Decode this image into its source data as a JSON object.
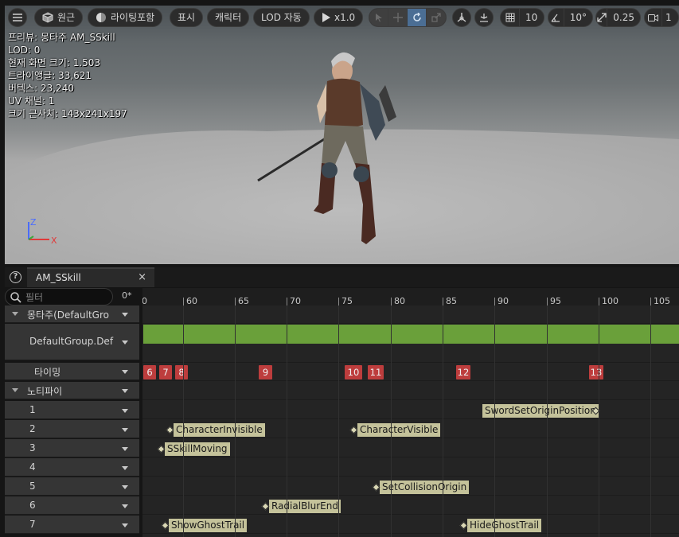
{
  "viewport": {
    "toolbar": {
      "perspective_label": "원근",
      "lighting_label": "라이팅포함",
      "show_label": "표시",
      "character_label": "캐릭터",
      "lod_label": "LOD 자동",
      "play_speed_label": "x1.0",
      "grid_size": "10",
      "rotation_snap": "10°",
      "scale_snap": "0.25",
      "camera_speed": "1"
    },
    "stats": [
      "프리뷰: 몽타주 AM_SSkill",
      "LOD: 0",
      "현재 화면 크기: 1.503",
      "트라이앵글: 33,621",
      "버텍스: 23,240",
      "UV 채널: 1",
      "크기 근사치: 143x241x197"
    ],
    "axis": {
      "z": "Z",
      "x": "X"
    }
  },
  "tab": {
    "label": "AM_SSkill",
    "close": "×",
    "help": "?"
  },
  "filter": {
    "placeholder": "필터",
    "frame": "0*"
  },
  "tracks": [
    {
      "label": "몽타주(DefaultGro",
      "kind": "section"
    },
    {
      "label": "DefaultGroup.Def",
      "kind": "slot"
    },
    {
      "label": "타이밍",
      "kind": "timing"
    },
    {
      "label": "노티파이",
      "kind": "section"
    },
    {
      "label": "1",
      "kind": "notify"
    },
    {
      "label": "2",
      "kind": "notify"
    },
    {
      "label": "3",
      "kind": "notify"
    },
    {
      "label": "4",
      "kind": "notify"
    },
    {
      "label": "5",
      "kind": "notify"
    },
    {
      "label": "6",
      "kind": "notify"
    },
    {
      "label": "7",
      "kind": "notify"
    }
  ],
  "ruler": {
    "start_label": "0",
    "ticks": [
      "60",
      "65",
      "70",
      "75",
      "80",
      "85",
      "90",
      "95",
      "100",
      "105"
    ]
  },
  "timing_markers": [
    "6",
    "7",
    "8",
    "9",
    "10",
    "11",
    "12",
    "13"
  ],
  "notifies": [
    {
      "track": "1",
      "label": "SwordSetOriginPosition"
    },
    {
      "track": "2",
      "label": "CharacterInvisible"
    },
    {
      "track": "2",
      "label": "CharacterVisible"
    },
    {
      "track": "3",
      "label": "SSkillMoving"
    },
    {
      "track": "5",
      "label": "SetCollisionOrigin"
    },
    {
      "track": "6",
      "label": "RadialBlurEnd"
    },
    {
      "track": "7",
      "label": "ShowGhostTrail"
    },
    {
      "track": "7",
      "label": "HideGhostTrail"
    }
  ],
  "colors": {
    "montage_bar": "#6aa03a",
    "timing_marker": "#bd3d3d",
    "notify": "#c4c29a",
    "active_toggle": "#4b6e94"
  }
}
